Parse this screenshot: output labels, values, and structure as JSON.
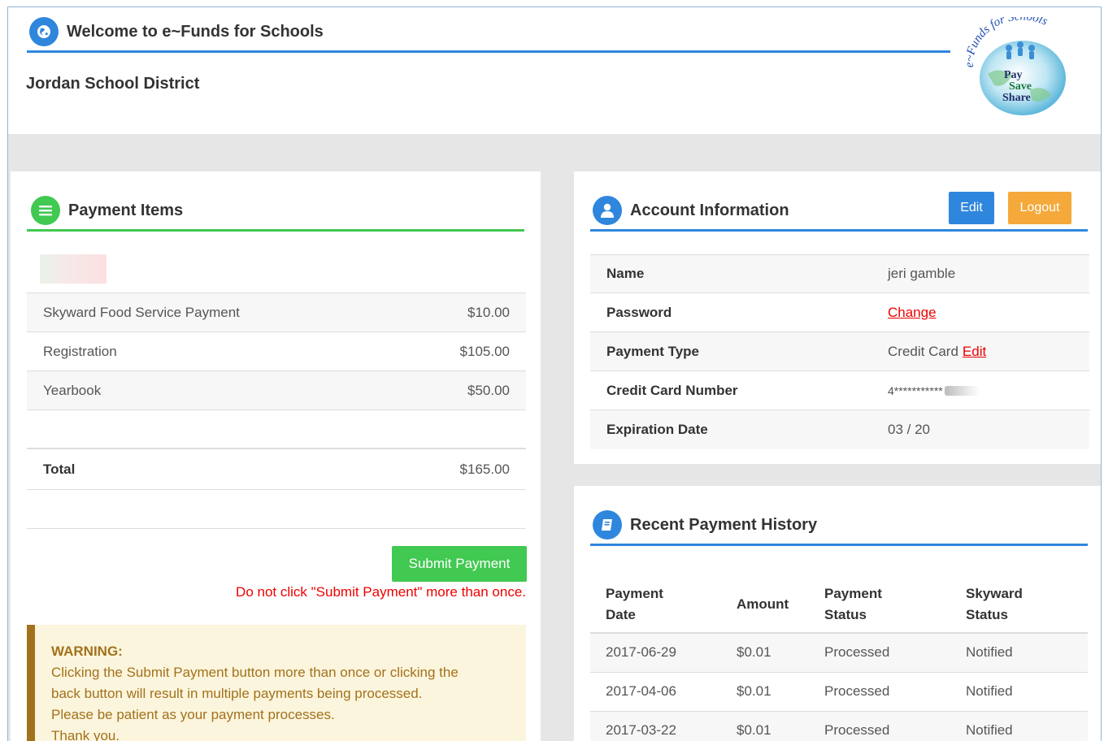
{
  "header": {
    "welcome": "Welcome to e~Funds for Schools",
    "district": "Jordan School District",
    "logo": {
      "top_text": "e~Funds for Schools",
      "line1": "Pay",
      "line2": "Save",
      "line3": "Share"
    }
  },
  "payment_items": {
    "title": "Payment Items",
    "items": [
      {
        "name": "Skyward Food Service Payment",
        "amount": "$10.00"
      },
      {
        "name": "Registration",
        "amount": "$105.00"
      },
      {
        "name": "Yearbook",
        "amount": "$50.00"
      }
    ],
    "total_label": "Total",
    "total_amount": "$165.00",
    "submit_label": "Submit Payment",
    "submit_note": "Do not click \"Submit Payment\" more than once.",
    "warning_title": "WARNING:",
    "warning_lines": [
      "Clicking the Submit Payment button more than once or clicking the",
      "back button will result in multiple payments being processed.",
      "Please be patient as your payment processes.",
      "Thank you."
    ]
  },
  "account": {
    "title": "Account Information",
    "edit_label": "Edit",
    "logout_label": "Logout",
    "rows": {
      "name_label": "Name",
      "name_value": "jeri gamble",
      "password_label": "Password",
      "password_link": "Change",
      "payment_type_label": "Payment Type",
      "payment_type_value": "Credit Card",
      "payment_type_link": "Edit",
      "card_label": "Credit Card Number",
      "card_value": "4***********",
      "exp_label": "Expiration Date",
      "exp_value": "03 / 20"
    }
  },
  "history": {
    "title": "Recent Payment History",
    "columns": {
      "date_1": "Payment",
      "date_2": "Date",
      "amount": "Amount",
      "status_1": "Payment",
      "status_2": "Status",
      "skyward_1": "Skyward",
      "skyward_2": "Status"
    },
    "rows": [
      {
        "date": "2017-06-29",
        "amount": "$0.01",
        "status": "Processed",
        "skyward": "Notified"
      },
      {
        "date": "2017-04-06",
        "amount": "$0.01",
        "status": "Processed",
        "skyward": "Notified"
      },
      {
        "date": "2017-03-22",
        "amount": "$0.01",
        "status": "Processed",
        "skyward": "Notified"
      }
    ]
  },
  "colors": {
    "blue": "#2f86dd",
    "green": "#41c952",
    "orange": "#f4a93a",
    "warning_text": "#a2711c",
    "warning_bg": "#fcf5dd",
    "link_red": "#e00000"
  },
  "icons": {
    "welcome": "globe-icon",
    "payment_items": "list-icon",
    "account": "user-icon",
    "history": "book-icon"
  }
}
